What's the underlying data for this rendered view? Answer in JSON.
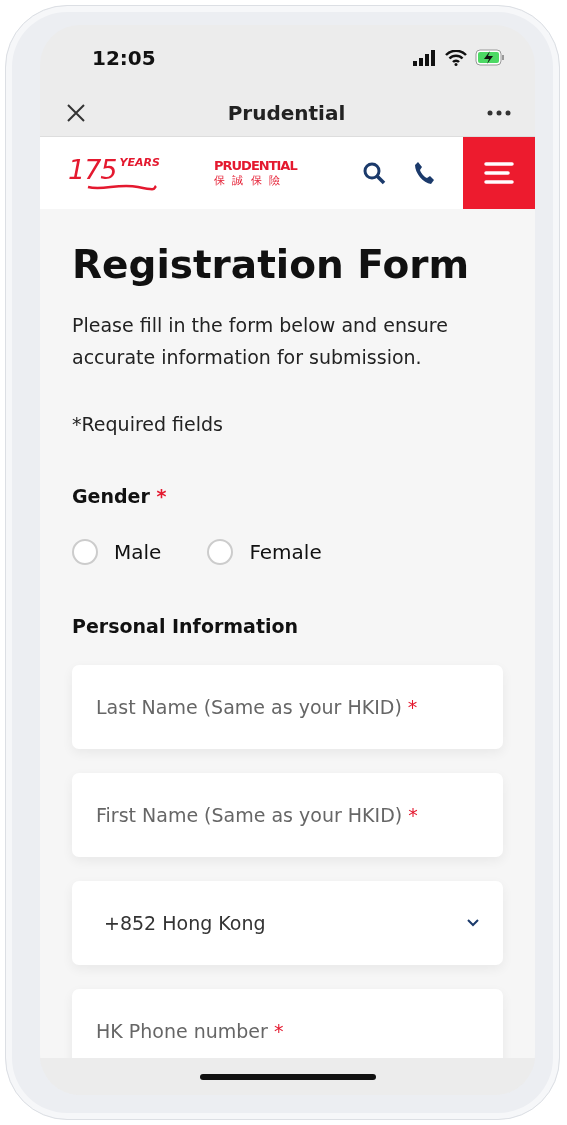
{
  "status_bar": {
    "time": "12:05"
  },
  "browser_bar": {
    "title": "Prudential"
  },
  "site_header": {
    "anniversary_logo": {
      "number": "175",
      "word": "YEARS"
    },
    "brand_logo": {
      "name": "PRUDENTIAL",
      "chinese": "保 誠 保 險"
    }
  },
  "form": {
    "title": "Registration Form",
    "intro": "Please fill in the form below and ensure accurate information for submission.",
    "required_note": "*Required fields",
    "gender": {
      "label": "Gender",
      "required_mark": "*",
      "options": [
        {
          "label": "Male",
          "selected": false
        },
        {
          "label": "Female",
          "selected": false
        }
      ]
    },
    "section_title": "Personal Information",
    "fields": [
      {
        "kind": "text",
        "placeholder": "Last Name (Same as your HKID)",
        "required_mark": "*"
      },
      {
        "kind": "text",
        "placeholder": "First Name (Same as your HKID)",
        "required_mark": "*"
      },
      {
        "kind": "select",
        "value": "+852 Hong Kong"
      },
      {
        "kind": "text",
        "placeholder": "HK Phone number",
        "required_mark": "*"
      }
    ]
  }
}
